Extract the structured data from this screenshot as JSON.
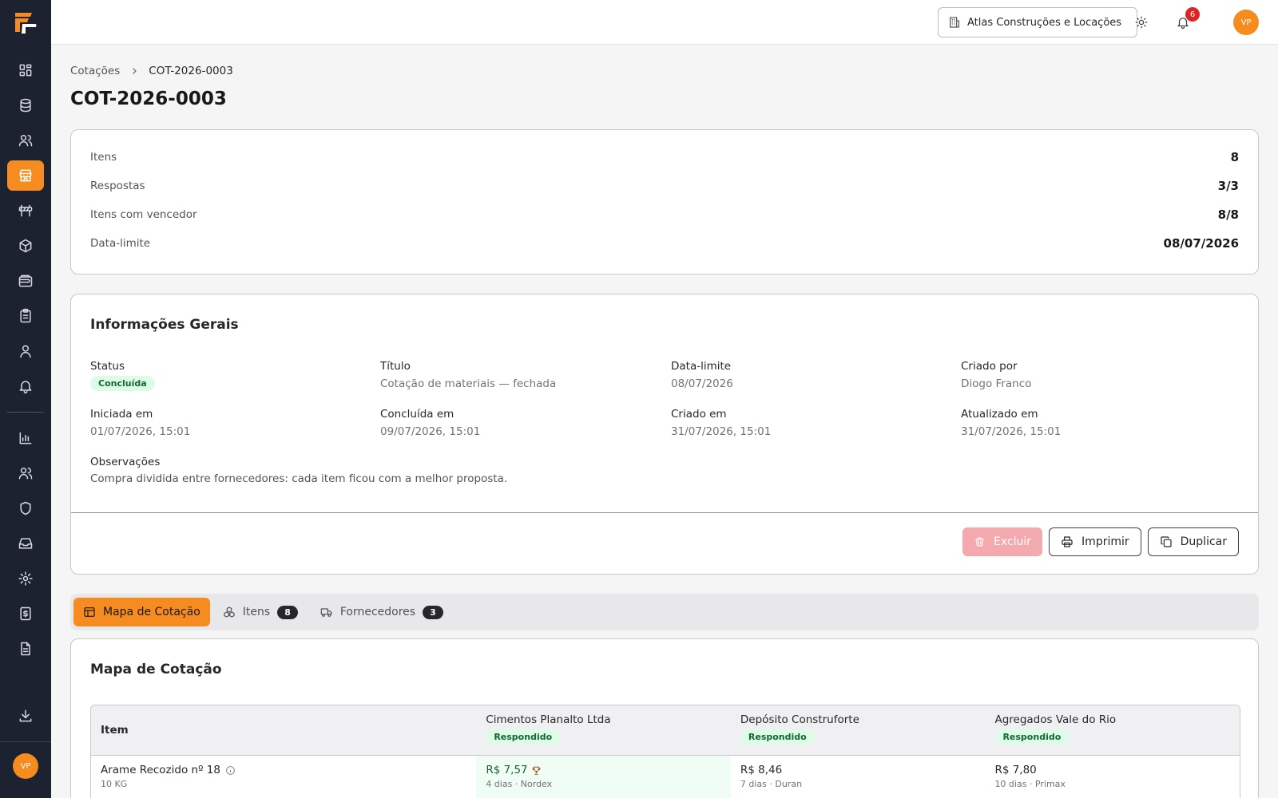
{
  "topbar": {
    "company": "Atlas Construções e Locações",
    "notification_count": "6",
    "avatar_initials": "VP"
  },
  "sidebar": {
    "avatar_initials": "VP",
    "items": [
      {
        "icon": "dashboard-icon",
        "active": false
      },
      {
        "icon": "database-icon",
        "active": false
      },
      {
        "icon": "users-icon",
        "active": false
      },
      {
        "icon": "store-icon",
        "active": true
      },
      {
        "icon": "barrier-icon",
        "active": false
      },
      {
        "icon": "package-icon",
        "active": false
      },
      {
        "icon": "wallet-icon",
        "active": false
      },
      {
        "icon": "clipboard-icon",
        "active": false
      },
      {
        "icon": "user-icon",
        "active": false
      },
      {
        "icon": "bell-icon",
        "active": false
      }
    ]
  },
  "breadcrumb": {
    "parent": "Cotações",
    "current": "COT-2026-0003"
  },
  "page": {
    "title": "COT-2026-0003"
  },
  "stats": [
    {
      "label": "Itens",
      "value": "8"
    },
    {
      "label": "Respostas",
      "value": "3/3"
    },
    {
      "label": "Itens com vencedor",
      "value": "8/8"
    },
    {
      "label": "Data-limite",
      "value": "08/07/2026"
    }
  ],
  "info": {
    "title": "Informações Gerais",
    "status_label": "Status",
    "status_value": "Concluída",
    "titulo_label": "Título",
    "titulo_value": "Cotação de materiais — fechada",
    "deadline_label": "Data-limite",
    "deadline_value": "08/07/2026",
    "created_by_label": "Criado por",
    "created_by_value": "Diogo Franco",
    "started_label": "Iniciada em",
    "started_value": "01/07/2026, 15:01",
    "completed_label": "Concluída em",
    "completed_value": "09/07/2026, 15:01",
    "created_label": "Criado em",
    "created_value": "31/07/2026, 15:01",
    "updated_label": "Atualizado em",
    "updated_value": "31/07/2026, 15:01",
    "notes_label": "Observações",
    "notes_value": "Compra dividida entre fornecedores: cada item ficou com a melhor proposta."
  },
  "actions": {
    "delete": "Excluir",
    "print": "Imprimir",
    "duplicate": "Duplicar"
  },
  "tabs": [
    {
      "label": "Mapa de Cotação",
      "count": null
    },
    {
      "label": "Itens",
      "count": "8"
    },
    {
      "label": "Fornecedores",
      "count": "3"
    }
  ],
  "map": {
    "title": "Mapa de Cotação",
    "item_header": "Item",
    "suppliers": [
      {
        "name": "Cimentos Planalto Ltda",
        "status": "Respondido"
      },
      {
        "name": "Depósito Construforte",
        "status": "Respondido"
      },
      {
        "name": "Agregados Vale do Rio",
        "status": "Respondido"
      }
    ],
    "rows": [
      {
        "item": "Arame Recozido nº 18",
        "unit": "10 KG",
        "quotes": [
          {
            "price": "R$ 7,57",
            "meta": "4 dias · Nordex",
            "best": true
          },
          {
            "price": "R$ 8,46",
            "meta": "7 dias · Duran",
            "best": false
          },
          {
            "price": "R$ 7,80",
            "meta": "10 dias · Primax",
            "best": false
          }
        ]
      }
    ]
  }
}
